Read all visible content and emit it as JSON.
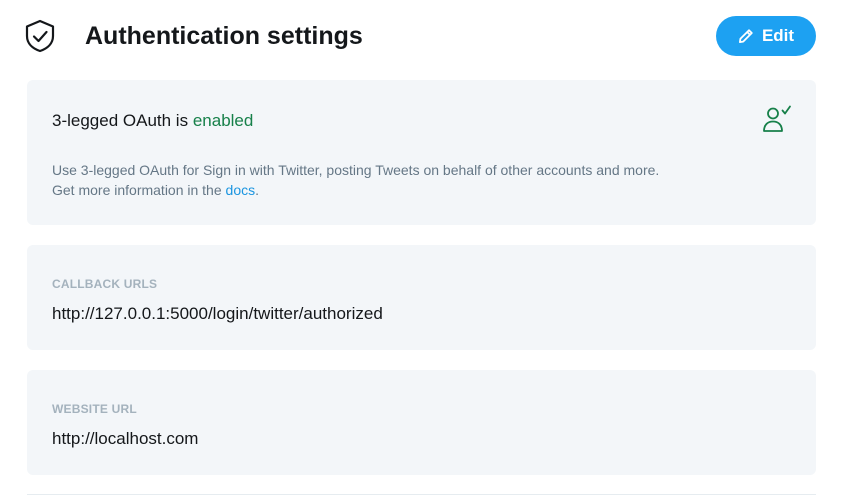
{
  "header": {
    "icon": "shield-check-icon",
    "title": "Authentication settings",
    "edit_button": {
      "label": "Edit",
      "icon": "pencil-icon",
      "color": "#1da1f2"
    }
  },
  "oauth": {
    "prefix": "3-legged OAuth is",
    "status": "enabled",
    "status_color": "#17804a",
    "icon": "user-check-icon",
    "description_line1": "Use 3-legged OAuth for Sign in with Twitter, posting Tweets on behalf of other accounts and more.",
    "description_line2_prefix": "Get more information in the",
    "docs_link": "docs",
    "description_line2_suffix": "."
  },
  "callback": {
    "label": "CALLBACK URLS",
    "value": "http://127.0.0.1:5000/login/twitter/authorized"
  },
  "website": {
    "label": "WEBSITE URL",
    "value": "http://localhost.com"
  }
}
